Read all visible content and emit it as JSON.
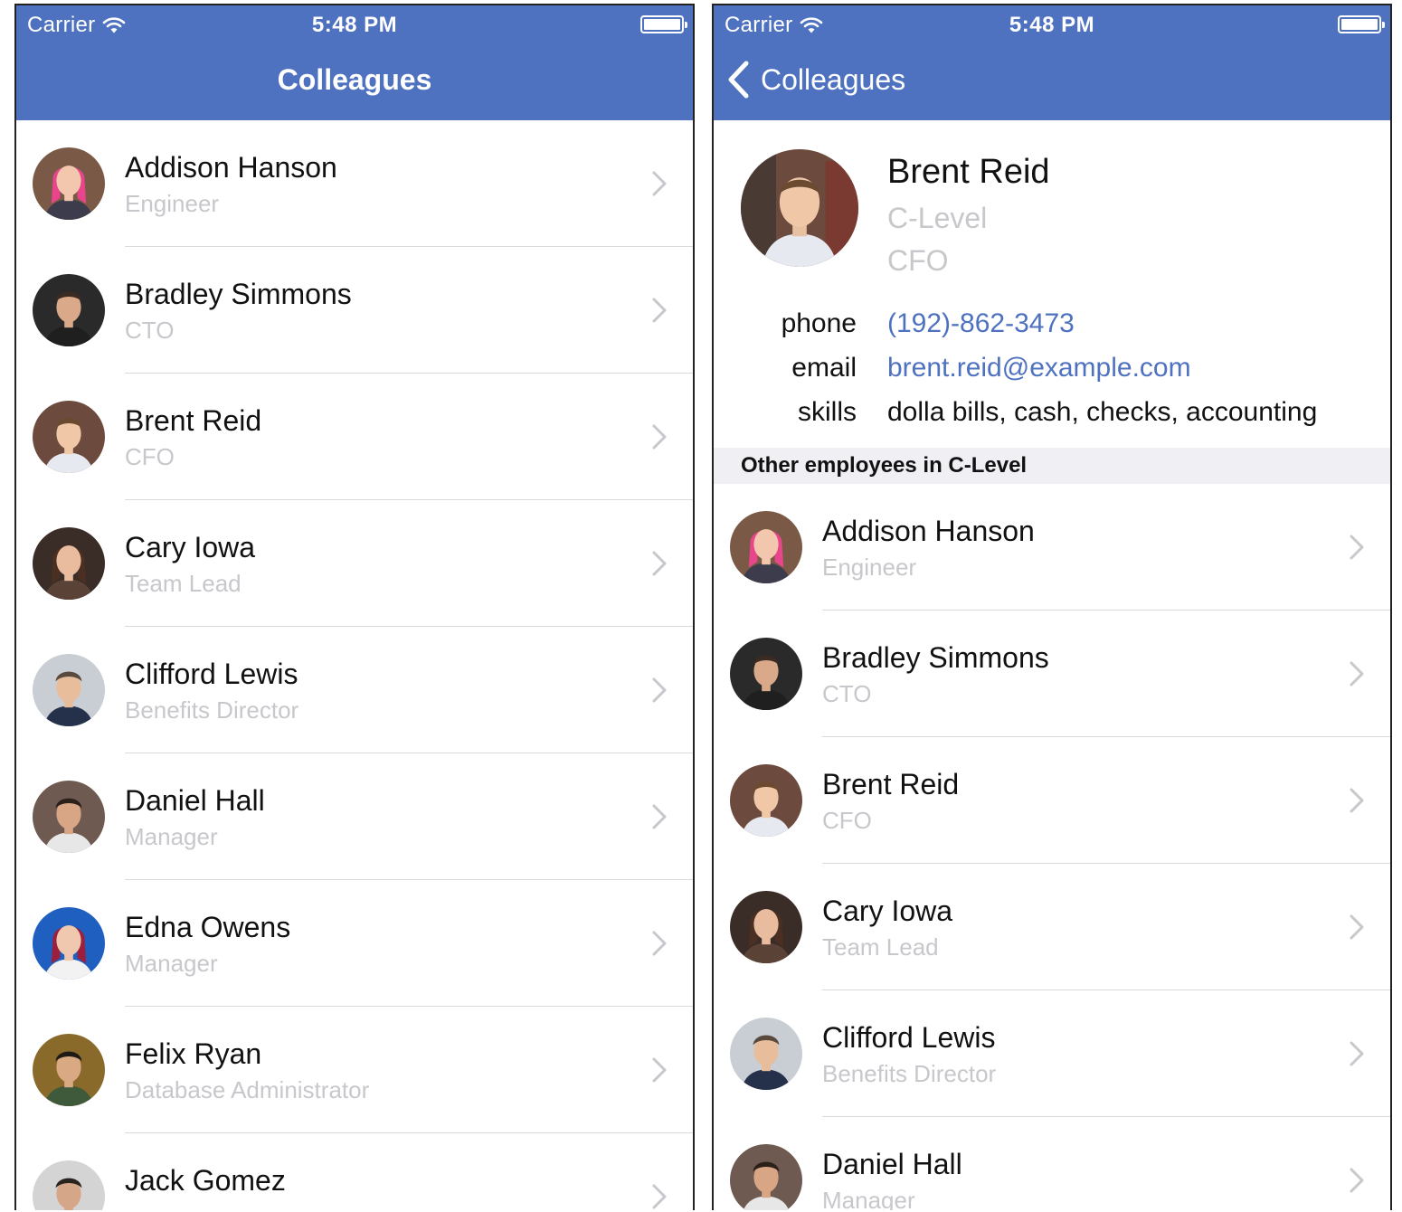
{
  "status_bar": {
    "carrier": "Carrier",
    "time": "5:48 PM"
  },
  "left_screen": {
    "title": "Colleagues",
    "rows": [
      {
        "name": "Addison Hanson",
        "role": "Engineer"
      },
      {
        "name": "Bradley Simmons",
        "role": "CTO"
      },
      {
        "name": "Brent Reid",
        "role": "CFO"
      },
      {
        "name": "Cary Iowa",
        "role": "Team Lead"
      },
      {
        "name": "Clifford Lewis",
        "role": "Benefits Director"
      },
      {
        "name": "Daniel Hall",
        "role": "Manager"
      },
      {
        "name": "Edna Owens",
        "role": "Manager"
      },
      {
        "name": "Felix Ryan",
        "role": "Database Administrator"
      },
      {
        "name": "Jack Gomez",
        "role": ""
      }
    ]
  },
  "right_screen": {
    "back_label": "Colleagues",
    "profile": {
      "name": "Brent Reid",
      "department": "C-Level",
      "title": "CFO"
    },
    "fields": {
      "phone": {
        "label": "phone",
        "value": "(192)-862-3473"
      },
      "email": {
        "label": "email",
        "value": "brent.reid@example.com"
      },
      "skills": {
        "label": "skills",
        "value": "dolla bills, cash, checks, accounting"
      }
    },
    "section_header": "Other employees in C-Level",
    "rows": [
      {
        "name": "Addison Hanson",
        "role": "Engineer"
      },
      {
        "name": "Bradley Simmons",
        "role": "CTO"
      },
      {
        "name": "Brent Reid",
        "role": "CFO"
      },
      {
        "name": "Cary Iowa",
        "role": "Team Lead"
      },
      {
        "name": "Clifford Lewis",
        "role": "Benefits Director"
      },
      {
        "name": "Daniel Hall",
        "role": "Manager"
      }
    ]
  },
  "colors": {
    "nav_bar": "#4f72c0",
    "link": "#4f72c0",
    "secondary_text": "#c7c7cc",
    "section_header_bg": "#efeff4",
    "separator": "#d9d9de"
  },
  "icons": [
    "wifi-icon",
    "battery-icon",
    "chevron-right-icon",
    "chevron-left-icon"
  ]
}
